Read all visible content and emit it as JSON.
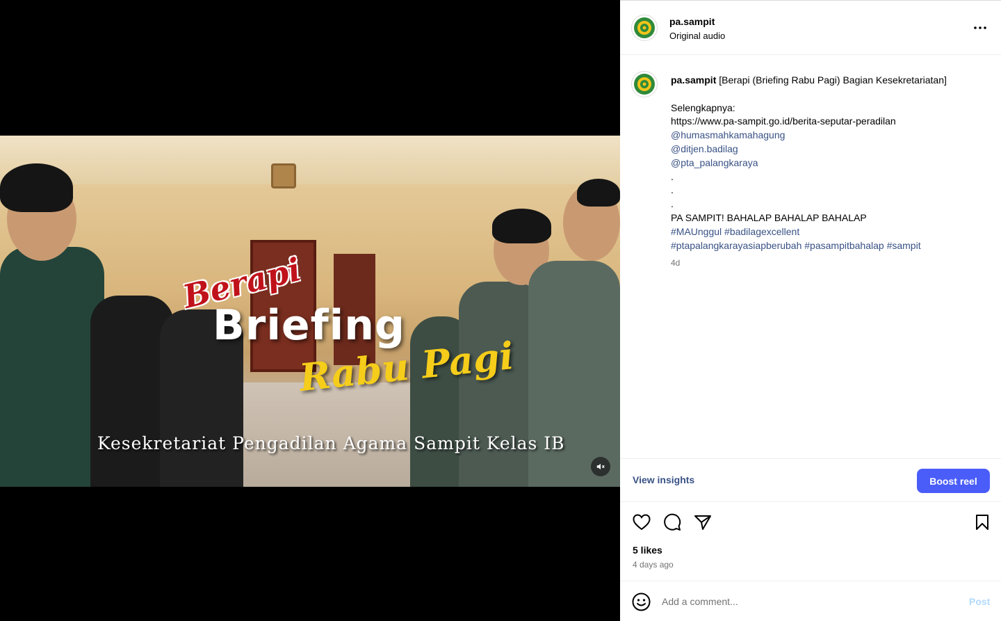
{
  "post": {
    "username": "pa.sampit",
    "audio": "Original audio",
    "caption": {
      "username": "pa.sampit",
      "title": "[Berapi (Briefing Rabu Pagi) Bagian Kesekretariatan]",
      "more_label": "Selengkapnya:",
      "url": "https://www.pa-sampit.go.id/berita-seputar-peradilan",
      "mentions": [
        "@humasmahkamahagung",
        "@ditjen.badilag",
        "@pta_palangkaraya"
      ],
      "dots": [
        ".",
        ".",
        "."
      ],
      "slogan": "PA SAMPIT! BAHALAP BAHALAP BAHALAP",
      "hashtags_line1": "#MAUnggul #badilagexcellent",
      "hashtags_line2": "#ptapalangkarayasiapberubah #pasampitbahalap #sampit",
      "time": "4d"
    },
    "video_overlay": {
      "berapi": "Berapi",
      "briefing": "Briefing",
      "rabu_pagi": "Rabu Pagi",
      "subtitle": "Kesekretariat Pengadilan Agama Sampit Kelas IB"
    },
    "insights_label": "View insights",
    "boost_label": "Boost reel",
    "likes": "5 likes",
    "posted_ago": "4 days ago",
    "comment_placeholder": "Add a comment...",
    "post_label": "Post"
  },
  "icons": {
    "more": "more-horizontal-icon",
    "like": "heart-icon",
    "comment": "comment-icon",
    "share": "share-icon",
    "save": "bookmark-icon",
    "emoji": "emoji-icon",
    "mute": "muted-speaker-icon"
  },
  "colors": {
    "link": "#385185",
    "boost": "#4a5df9",
    "post_disabled": "#b3dbff",
    "secondary_text": "#737373"
  }
}
